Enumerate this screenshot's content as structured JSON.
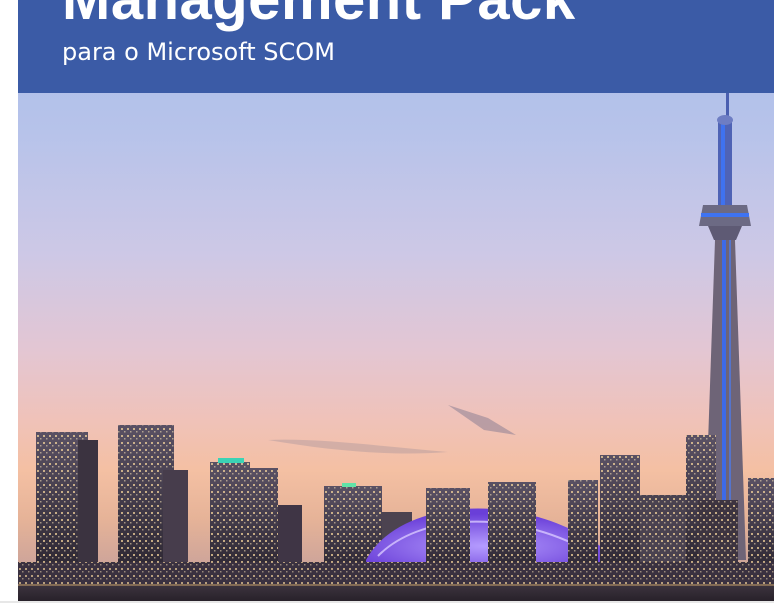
{
  "header": {
    "title": "Management Pack",
    "subtitle": "para o Microsoft SCOM"
  },
  "colors": {
    "header_band": "#3b5ba6",
    "tower_light": "#3d6ae8",
    "dome_light": "#7a4df0"
  },
  "image": {
    "subject": "city skyline at dusk"
  }
}
